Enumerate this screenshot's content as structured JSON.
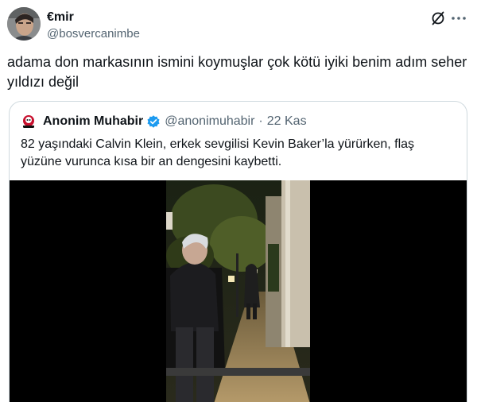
{
  "tweet": {
    "author": {
      "display_name": "€mir",
      "handle": "@bosvercanimbe"
    },
    "text": "adama don markasının ismini koymuşlar çok kötü iyiki benim adım seher yıldızı değil",
    "actions": {
      "grok_icon": "grok-icon",
      "more_icon": "more-dots-icon"
    }
  },
  "quote": {
    "author": {
      "display_name": "Anonim Muhabir",
      "handle": "@anonimuhabir",
      "separator": "·",
      "time": "22 Kas",
      "verified_icon": "verified-badge-icon"
    },
    "text": "82 yaşındaki Calvin Klein, erkek sevgilisi Kevin Baker’la yürürken, flaş yüzüne vurunca kısa bir an dengesini kaybetti.",
    "media": {
      "type": "video"
    }
  },
  "colors": {
    "text_primary": "#0f1419",
    "text_secondary": "#536471",
    "border": "#cfd9de",
    "verified": "#1d9bf0",
    "video_bg": "#000000"
  }
}
